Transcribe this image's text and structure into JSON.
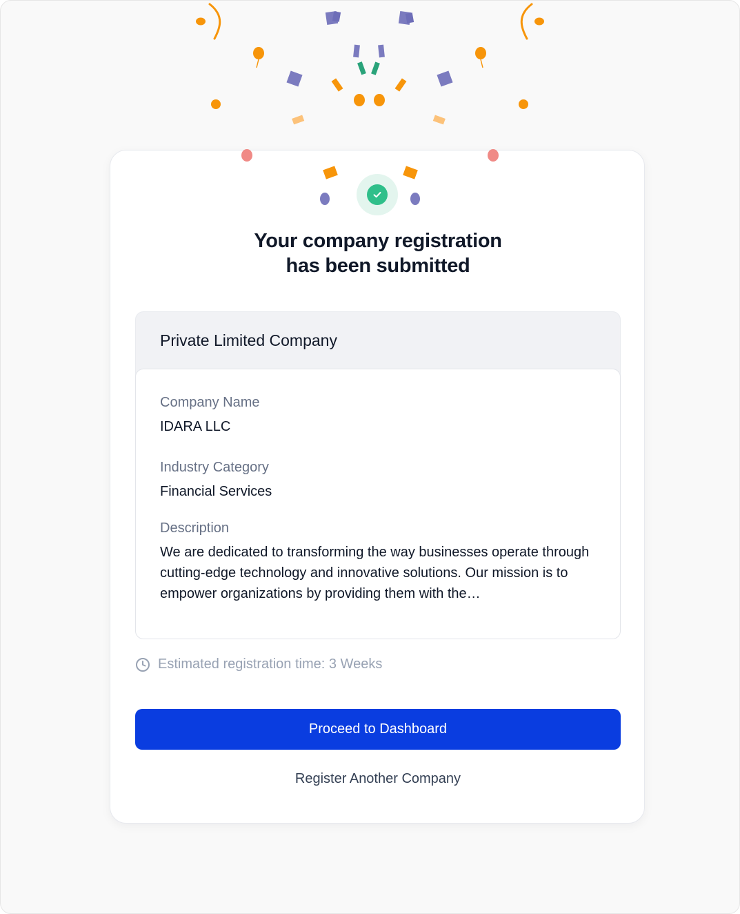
{
  "header": {
    "title_line1": "Your company registration",
    "title_line2": "has been submitted",
    "status_icon": "check-circle-icon",
    "success_color": "#2fbf8a"
  },
  "details": {
    "company_type": "Private Limited Company",
    "fields": [
      {
        "label": "Company Name",
        "value": "IDARA LLC"
      },
      {
        "label": "Industry Category",
        "value": "Financial Services"
      },
      {
        "label": "Description",
        "value": "We are dedicated to transforming the way businesses operate through cutting-edge technology and innovative solutions. Our mission is to empower organizations by providing them with the…"
      }
    ]
  },
  "eta": {
    "icon": "clock-icon",
    "text": "Estimated registration time: 3 Weeks"
  },
  "actions": {
    "primary_label": "Proceed to Dashboard",
    "secondary_label": "Register Another Company",
    "primary_color": "#0a3de0"
  },
  "confetti_colors": {
    "orange": "#f7950a",
    "purple": "#7b7bbf",
    "green": "#2aa37a",
    "pink": "#f08a86",
    "light_orange": "#fcc27a"
  }
}
